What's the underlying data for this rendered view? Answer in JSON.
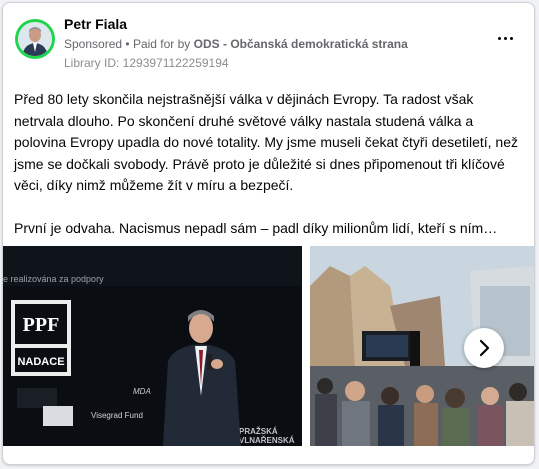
{
  "post": {
    "author": "Petr Fiala",
    "sponsored": "Sponsored",
    "paid_prefix": "Paid for by",
    "payer": "ODS - Občanská demokratická strana",
    "library_id": "Library ID: 1293971122259194",
    "paragraph1": "Před 80 lety skončila nejstrašnější válka v dějinách Evropy. Ta radost však netrvala dlouho. Po skončení druhé světové války nastala studená válka a polovina Evropy upadla do nové totality. My jsme museli čekat čtyři desetiletí, než jsme se dočkali svobody. Právě proto je důležité si dnes připomenout tři klíčové věci, díky nimž můžeme žít v míru a bezpečí.",
    "paragraph2": "První je odvaha. Nacismus nepadl sám – padl díky milionům lidí, kteří s ním…"
  },
  "images": {
    "photo1": {
      "backdrop_text": "je realizována za podpory",
      "logo": "PPF",
      "logo_sub": "NADACE",
      "fund_text": "Visegrad Fund",
      "mda_text": "MDA",
      "side_text1": "PRAŽSKÁ",
      "side_text2": "VLNAŘENSKÁ"
    }
  },
  "icons": {
    "more": "more-horizontal-icon",
    "next": "chevron-right-icon"
  },
  "colors": {
    "avatar_ring": "#1dd64b",
    "text": "#050505",
    "muted": "#65676b"
  }
}
